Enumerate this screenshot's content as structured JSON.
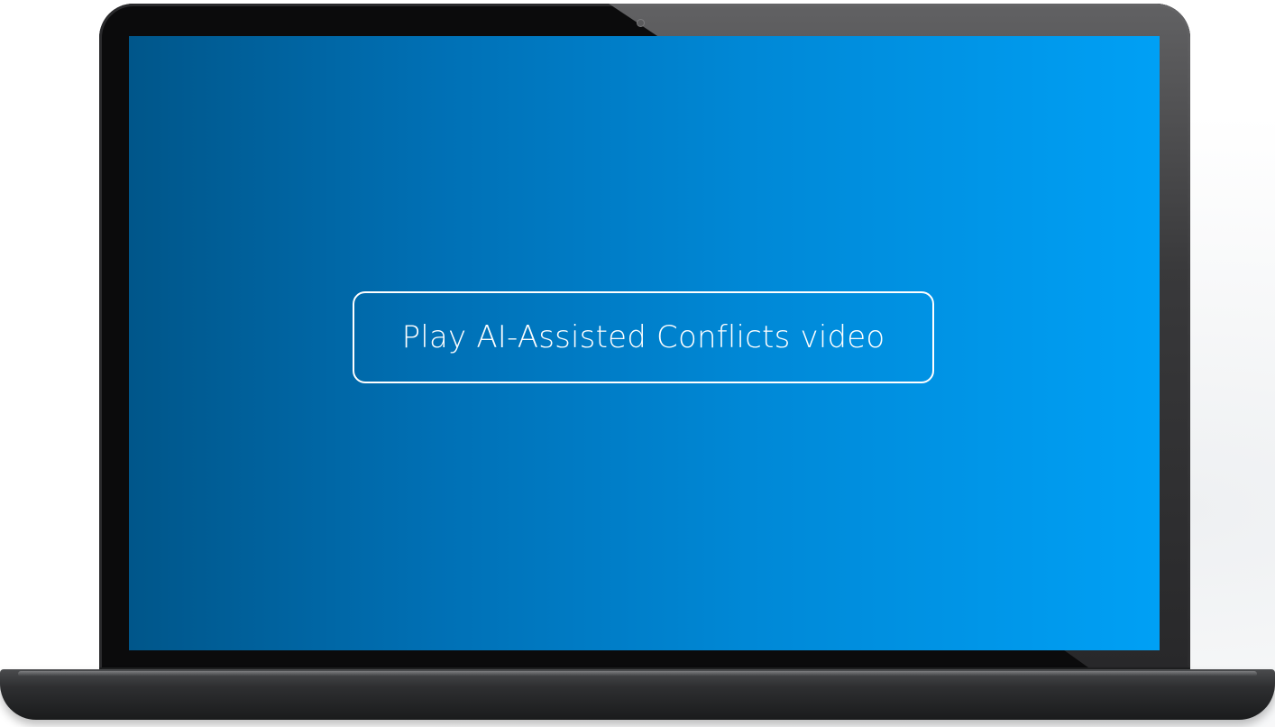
{
  "screen": {
    "play_button_label": "Play AI-Assisted Conflicts video"
  },
  "colors": {
    "screen_gradient_start": "#00568a",
    "screen_gradient_end": "#00a0f5",
    "button_border": "#ffffff",
    "bezel": "#0b0b0c"
  },
  "icons": {
    "camera": "webcam-icon"
  }
}
